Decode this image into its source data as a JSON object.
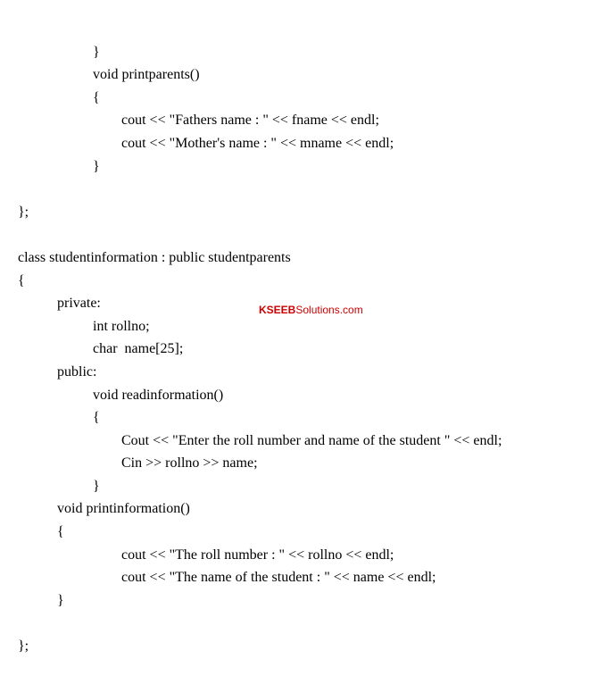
{
  "code": {
    "line1": "                     }",
    "line2": "                     void printparents()",
    "line3": "                     {",
    "line4": "                             cout << \"Fathers name : \" << fname << endl;",
    "line5": "                             cout << \"Mother's name : \" << mname << endl;",
    "line6": "                     }",
    "line7": "",
    "line8": "};",
    "line9": "",
    "line10": "class studentinformation : public studentparents",
    "line11": "{",
    "line12": "           private:",
    "line13": "                     int rollno;",
    "line14": "                     char  name[25];",
    "line15": "           public:",
    "line16": "                     void readinformation()",
    "line17": "                     {",
    "line18": "                             Cout << \"Enter the roll number and name of the student \" << endl;",
    "line19": "                             Cin >> rollno >> name;",
    "line20": "                     }",
    "line21": "           void printinformation()",
    "line22": "           {",
    "line23": "                             cout << \"The roll number : \" << rollno << endl;",
    "line24": "                             cout << \"The name of the student : \" << name << endl;",
    "line25": "           }",
    "line26": "",
    "line27": "};"
  },
  "watermark": {
    "prefix": "KSEEB",
    "suffix": "Solutions.com"
  }
}
